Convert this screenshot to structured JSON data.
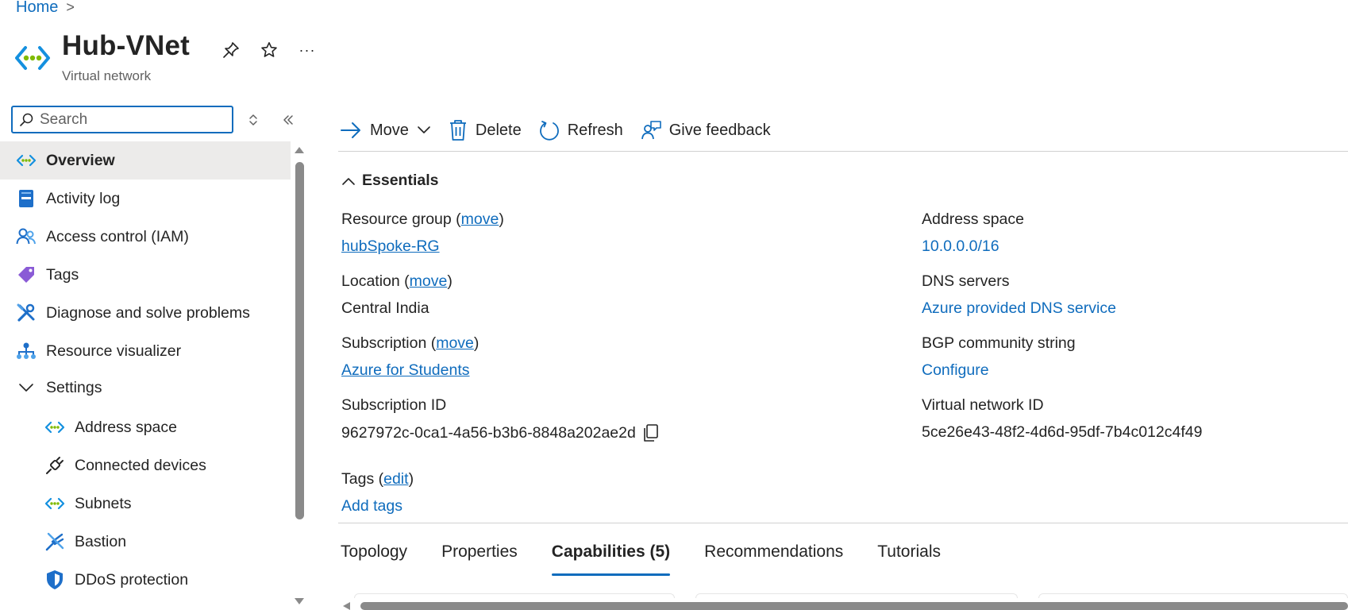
{
  "breadcrumb": {
    "home": "Home",
    "separator": ">"
  },
  "header": {
    "title": "Hub-VNet",
    "subtitle": "Virtual network",
    "icon": "virtual-network-icon",
    "actions": {
      "pin": "pin-icon",
      "favorite": "star-icon",
      "more": "···"
    }
  },
  "sidebar": {
    "search_placeholder": "Search",
    "items": [
      {
        "label": "Overview",
        "icon": "virtual-network-icon",
        "active": true
      },
      {
        "label": "Activity log",
        "icon": "activity-log-icon"
      },
      {
        "label": "Access control (IAM)",
        "icon": "people-icon"
      },
      {
        "label": "Tags",
        "icon": "tag-icon"
      },
      {
        "label": "Diagnose and solve problems",
        "icon": "wrench-icon"
      },
      {
        "label": "Resource visualizer",
        "icon": "hierarchy-icon"
      },
      {
        "label": "Settings",
        "icon": "chevron-down-icon",
        "expanded": true
      },
      {
        "label": "Address space",
        "icon": "virtual-network-icon"
      },
      {
        "label": "Connected devices",
        "icon": "plug-icon"
      },
      {
        "label": "Subnets",
        "icon": "virtual-network-icon"
      },
      {
        "label": "Bastion",
        "icon": "bastion-icon"
      },
      {
        "label": "DDoS protection",
        "icon": "shield-icon"
      }
    ]
  },
  "toolbar": {
    "move": "Move",
    "delete": "Delete",
    "refresh": "Refresh",
    "feedback": "Give feedback"
  },
  "essentials": {
    "title": "Essentials",
    "resource_group": {
      "label": "Resource group (",
      "link": "move",
      "close": ")",
      "value": "hubSpoke-RG"
    },
    "location": {
      "label": "Location (",
      "link": "move",
      "close": ")",
      "value": "Central India"
    },
    "subscription": {
      "label": "Subscription (",
      "link": "move",
      "close": ")",
      "value": "Azure for Students"
    },
    "subscription_id": {
      "label": "Subscription ID",
      "value": "9627972c-0ca1-4a56-b3b6-8848a202ae2d"
    },
    "address_space": {
      "label": "Address space",
      "value": "10.0.0.0/16"
    },
    "dns_servers": {
      "label": "DNS servers",
      "value": "Azure provided DNS service"
    },
    "bgp": {
      "label": "BGP community string",
      "value": "Configure"
    },
    "vnet_id": {
      "label": "Virtual network ID",
      "value": "5ce26e43-48f2-4d6d-95df-7b4c012c4f49"
    },
    "tags": {
      "label": "Tags (",
      "link": "edit",
      "close": ")",
      "value": "Add tags"
    }
  },
  "tabs": [
    {
      "label": "Topology"
    },
    {
      "label": "Properties"
    },
    {
      "label": "Capabilities (5)",
      "active": true
    },
    {
      "label": "Recommendations"
    },
    {
      "label": "Tutorials"
    }
  ],
  "colors": {
    "accent": "#0f6cbd",
    "active_bg": "#ecebea",
    "text": "#242424"
  }
}
